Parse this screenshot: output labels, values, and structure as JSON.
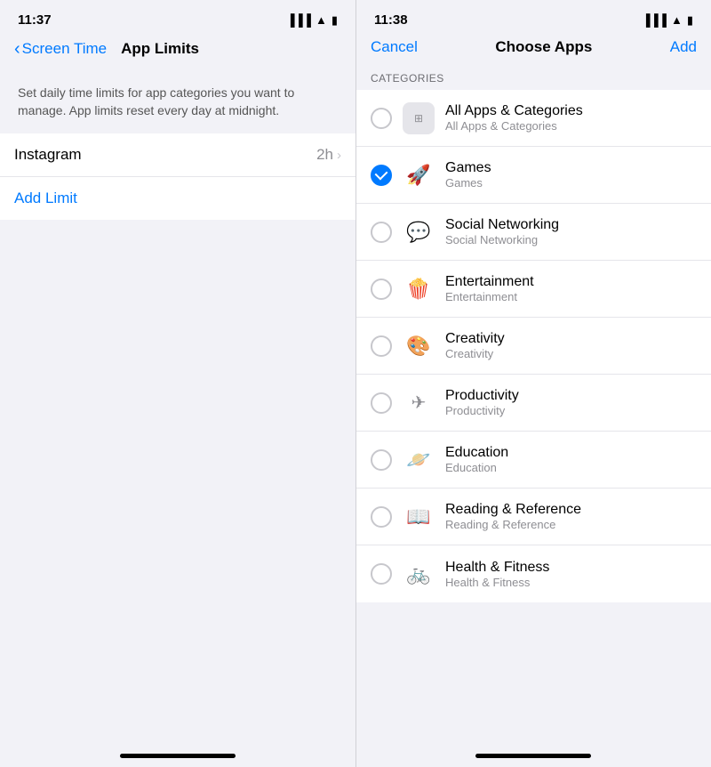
{
  "left": {
    "statusBar": {
      "time": "11:37",
      "icons": "▐▐▐ ▲ ▮"
    },
    "nav": {
      "backLabel": "Screen Time",
      "title": "App Limits"
    },
    "info": {
      "text": "Set daily time limits for app categories you want to manage. App limits reset every day at midnight."
    },
    "apps": [
      {
        "name": "Instagram",
        "time": "2h"
      }
    ],
    "addLimit": "Add Limit"
  },
  "right": {
    "statusBar": {
      "time": "11:38",
      "icons": "▐▐▐ ▲ ▮"
    },
    "nav": {
      "cancel": "Cancel",
      "title": "Choose Apps",
      "add": "Add"
    },
    "categoriesHeader": "CATEGORIES",
    "categories": [
      {
        "id": "all",
        "name": "All Apps & Categories",
        "sub": "All Apps & Categories",
        "icon": "🔲",
        "checked": false,
        "emoji": ""
      },
      {
        "id": "games",
        "name": "Games",
        "sub": "Games",
        "icon": "🚀",
        "checked": true,
        "emoji": "🚀"
      },
      {
        "id": "social",
        "name": "Social Networking",
        "sub": "Social Networking",
        "icon": "💬",
        "checked": false,
        "emoji": "💬"
      },
      {
        "id": "entertainment",
        "name": "Entertainment",
        "sub": "Entertainment",
        "icon": "🍿",
        "checked": false,
        "emoji": "🍿"
      },
      {
        "id": "creativity",
        "name": "Creativity",
        "sub": "Creativity",
        "icon": "🎨",
        "checked": false,
        "emoji": "🎨"
      },
      {
        "id": "productivity",
        "name": "Productivity",
        "sub": "Productivity",
        "icon": "✈️",
        "checked": false,
        "emoji": "✈️"
      },
      {
        "id": "education",
        "name": "Education",
        "sub": "Education",
        "icon": "🪐",
        "checked": false,
        "emoji": "🪐"
      },
      {
        "id": "reading",
        "name": "Reading & Reference",
        "sub": "Reading & Reference",
        "icon": "📖",
        "checked": false,
        "emoji": "📖"
      },
      {
        "id": "health",
        "name": "Health & Fitness",
        "sub": "Health & Fitness",
        "icon": "🚲",
        "checked": false,
        "emoji": "🚲"
      }
    ]
  }
}
